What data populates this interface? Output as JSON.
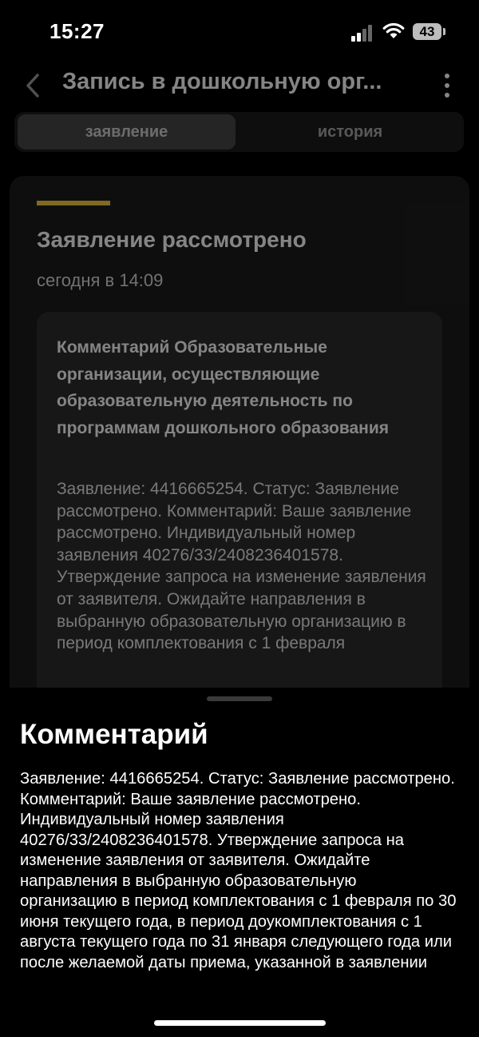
{
  "status_bar": {
    "time": "15:27",
    "battery": "43"
  },
  "header": {
    "title": "Запись в дошкольную орг..."
  },
  "tabs": [
    {
      "label": "заявление",
      "active": true
    },
    {
      "label": "история",
      "active": false
    }
  ],
  "card": {
    "title": "Заявление рассмотрено",
    "time": "сегодня в 14:09",
    "comment_heading": "Комментарий Образовательные организации, осуществляющие образовательную деятельность по программам дошкольного образования",
    "comment_body": "Заявление: 4416665254. Статус: Заявление рассмотрено. Комментарий: Ваше заявление рассмотрено. Индивидуальный номер заявления 40276/33/2408236401578. Утверждение запроса на изменение заявления от заявителя. Ожидайте направления в выбранную образовательную организацию в период комплектования с 1 февраля"
  },
  "sheet": {
    "title": "Комментарий",
    "body": "Заявление: 4416665254. Статус: Заявление рассмотрено. Комментарий: Ваше заявление рассмотрено. Индивидуальный номер заявления 40276/33/2408236401578. Утверждение запроса на изменение заявления от заявителя. Ожидайте направления в выбранную образовательную организацию в период комплектования с 1 февраля по 30 июня текущего года, в период доукомплектования с 1 августа текущего года по 31 января следующего года или после желаемой даты приема, указанной в заявлении"
  },
  "colors": {
    "accent": "#f1cc3f",
    "background": "#000000",
    "card": "#1c1c1e"
  }
}
